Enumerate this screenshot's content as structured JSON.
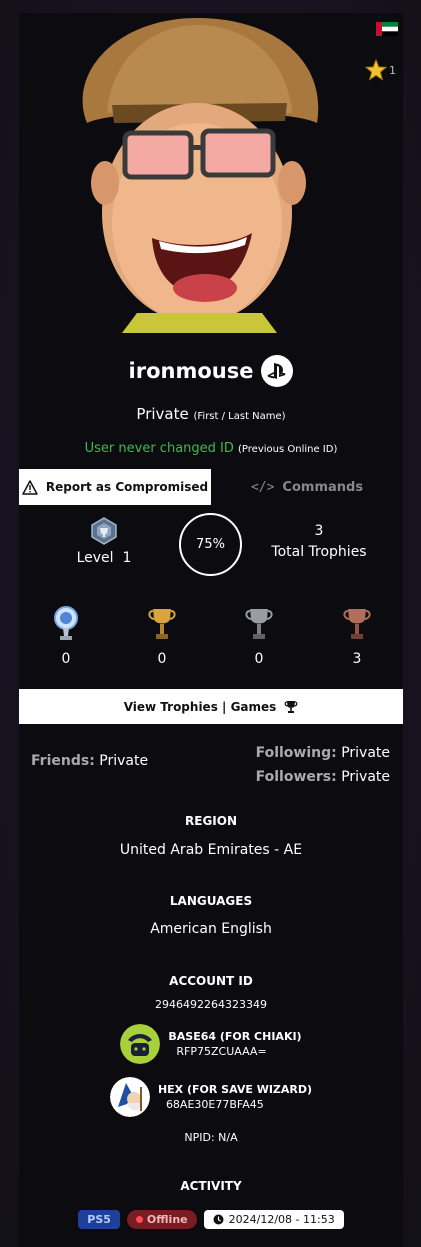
{
  "profile": {
    "username": "ironmouse",
    "region_flag": "ae-flag",
    "star_count": "1",
    "name_value": "Private",
    "name_hint": "(First / Last Name)",
    "id_value": "User never changed ID",
    "id_hint": "(Previous Online ID)"
  },
  "tabs": {
    "report_label": "Report as Compromised",
    "commands_label": "Commands"
  },
  "stats": {
    "level_label": "Level",
    "level_value": "1",
    "progress": "75%",
    "total_count": "3",
    "total_label": "Total Trophies"
  },
  "trophies": {
    "platinum": "0",
    "gold": "0",
    "silver": "0",
    "bronze": "3"
  },
  "view_button_label": "View Trophies | Games",
  "social": {
    "friends_label": "Friends:",
    "friends_value": "Private",
    "following_label": "Following:",
    "following_value": "Private",
    "followers_label": "Followers:",
    "followers_value": "Private"
  },
  "region": {
    "title": "REGION",
    "value": "United Arab Emirates - AE"
  },
  "languages": {
    "title": "LANGUAGES",
    "value": "American English"
  },
  "account": {
    "title": "ACCOUNT ID",
    "value": "2946492264323349",
    "base64_title": "BASE64 (FOR CHIAKI)",
    "base64_value": "RFP75ZCUAAA=",
    "hex_title": "HEX (FOR SAVE WIZARD)",
    "hex_value": "68AE30E77BFA45",
    "npid": "NPID: N/A"
  },
  "activity": {
    "title": "ACTIVITY",
    "platform": "PS5",
    "status": "Offline",
    "last_seen": "2024/12/08 - 11:53"
  },
  "colors": {
    "accent_green": "#3fb950",
    "ps5_blue": "#1e3f9b",
    "offline_red": "#7a1d22"
  }
}
